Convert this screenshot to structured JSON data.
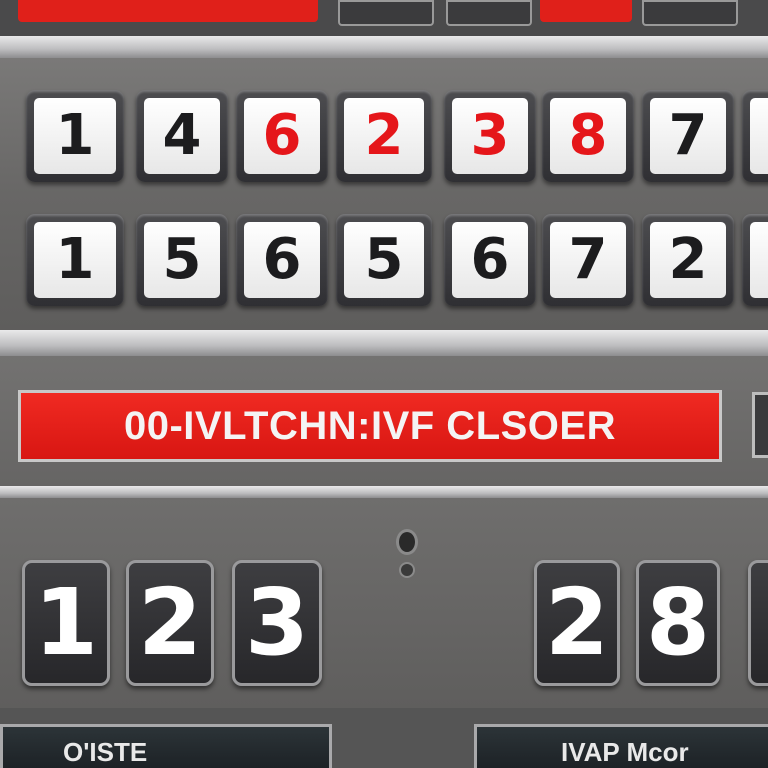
{
  "top_row": [
    {
      "digit": "1",
      "color": "#1c1c1e"
    },
    {
      "digit": "4",
      "color": "#1c1c1e"
    },
    {
      "digit": "6",
      "color": "#e5161a"
    },
    {
      "digit": "2",
      "color": "#e5161a"
    },
    {
      "digit": "3",
      "color": "#e5161a"
    },
    {
      "digit": "8",
      "color": "#e5161a"
    },
    {
      "digit": "7",
      "color": "#1c1c1e"
    },
    {
      "digit": "",
      "color": "#1c1c1e"
    }
  ],
  "middle_row": [
    {
      "digit": "1"
    },
    {
      "digit": "5"
    },
    {
      "digit": "6"
    },
    {
      "digit": "5"
    },
    {
      "digit": "6"
    },
    {
      "digit": "7"
    },
    {
      "digit": "2"
    },
    {
      "digit": ""
    }
  ],
  "banner": {
    "text": "00-IVLTCHN:IVF CLSOER",
    "color": "#e21b16"
  },
  "bottom_left": [
    "1",
    "2",
    "3"
  ],
  "bottom_right": [
    "2",
    "8",
    ""
  ],
  "labels": {
    "left": "O'ISTE",
    "right": "IVAP Mcor"
  },
  "colors": {
    "accent_red": "#e5161a",
    "panel_gray": "#6e6d6c",
    "tile_dark": "#2f2f33"
  }
}
